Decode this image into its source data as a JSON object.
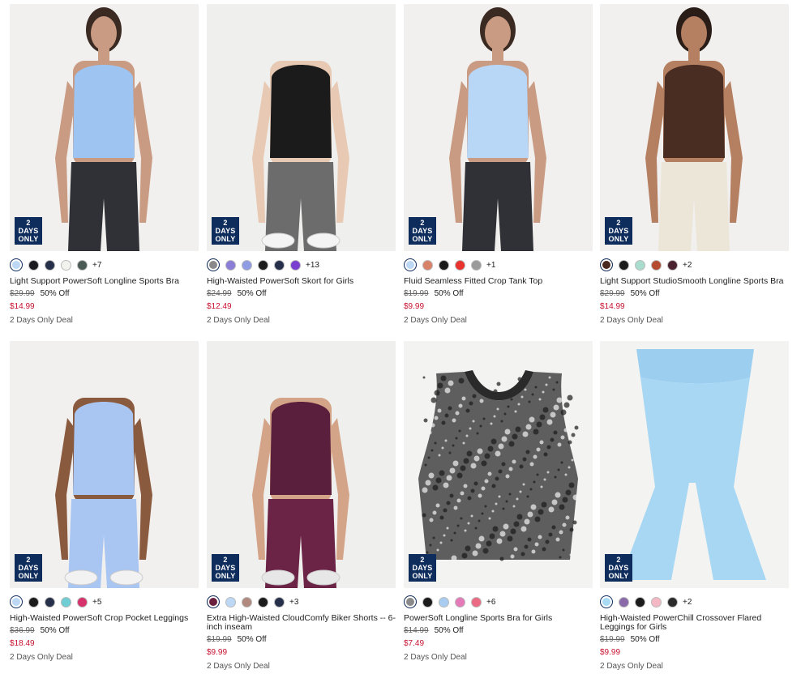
{
  "products": [
    {
      "name": "Light Support PowerSoft Longline Sports Bra",
      "orig_price": "$29.99",
      "discount": "50% Off",
      "sale_price": "$14.99",
      "deal": "2 Days Only Deal",
      "badge": "2 DAYS\nONLY",
      "swatches": [
        "#bcd8f5",
        "#1b1b1f",
        "#27304a",
        "#f2f2ee",
        "#4b5a54"
      ],
      "more": "+7",
      "image": {
        "bg": "#f1f0ee",
        "top": "#9ec4f2",
        "bottom": "#2f3136",
        "skin": "#c99b82",
        "hair": "#3a2a22",
        "shoes": "none"
      }
    },
    {
      "name": "High-Waisted PowerSoft Skort for Girls",
      "orig_price": "$24.99",
      "discount": "50% Off",
      "sale_price": "$12.49",
      "deal": "2 Days Only Deal",
      "badge": "2 DAYS\nONLY",
      "swatches": [
        "#8a8a8a",
        "#8a7ed6",
        "#8f9be2",
        "#1c1c1c",
        "#27304a",
        "#7a3fd0"
      ],
      "more": "+13",
      "image": {
        "bg": "#efefed",
        "top": "#1b1b1b",
        "bottom": "#6c6c6c",
        "skin": "#e8c9b3",
        "hair": "none",
        "shoes": "#f4f4f4"
      }
    },
    {
      "name": "Fluid Seamless Fitted Crop Tank Top",
      "orig_price": "$19.99",
      "discount": "50% Off",
      "sale_price": "$9.99",
      "deal": "2 Days Only Deal",
      "badge": "2 DAYS\nONLY",
      "swatches": [
        "#bcd8f5",
        "#d9826a",
        "#1b1b1b",
        "#e8332f",
        "#9a9a9a"
      ],
      "more": "+1",
      "image": {
        "bg": "#f1f0ee",
        "top": "#b8d6f6",
        "bottom": "#2f3136",
        "skin": "#c99b82",
        "hair": "#3a2a22",
        "shoes": "none"
      }
    },
    {
      "name": "Light Support StudioSmooth Longline Sports Bra",
      "orig_price": "$29.99",
      "discount": "50% Off",
      "sale_price": "$14.99",
      "deal": "2 Days Only Deal",
      "badge": "2 DAYS\nONLY",
      "swatches": [
        "#4a2a20",
        "#1b1b1b",
        "#a9dccd",
        "#b44a2e",
        "#4a2230"
      ],
      "more": "+2",
      "image": {
        "bg": "#f1f0ee",
        "top": "#4a2d22",
        "bottom": "#ece6d8",
        "skin": "#b57f62",
        "hair": "#2a1d17",
        "shoes": "none"
      }
    },
    {
      "name": "High-Waisted PowerSoft Crop Pocket Leggings",
      "orig_price": "$36.99",
      "discount": "50% Off",
      "sale_price": "$18.49",
      "deal": "2 Days Only Deal",
      "badge": "2 DAYS\nONLY",
      "swatches": [
        "#bcd8f5",
        "#1b1b1b",
        "#27304a",
        "#6fcdd3",
        "#d6336c"
      ],
      "more": "+5",
      "image": {
        "bg": "#f1f0ee",
        "top": "#a9c6f2",
        "bottom": "#a9c6f2",
        "skin": "#8a5a3e",
        "hair": "none",
        "shoes": "#f2f2f2"
      }
    },
    {
      "name": "Extra High-Waisted CloudComfy Biker Shorts -- 6-inch inseam",
      "orig_price": "$19.99",
      "discount": "50% Off",
      "sale_price": "$9.99",
      "deal": "2 Days Only Deal",
      "badge": "2 DAYS\nONLY",
      "swatches": [
        "#6b1f3e",
        "#bcd8f5",
        "#b08a7e",
        "#1b1b1b",
        "#27304a"
      ],
      "more": "+3",
      "image": {
        "bg": "#efefed",
        "top": "#5a1f3c",
        "bottom": "#6b2446",
        "skin": "#d4a488",
        "hair": "none",
        "shoes": "#e7e7e7"
      }
    },
    {
      "name": "PowerSoft Longline Sports Bra for Girls",
      "orig_price": "$14.99",
      "discount": "50% Off",
      "sale_price": "$7.49",
      "deal": "2 Days Only Deal",
      "badge": "2 DAYS\nONLY",
      "swatches": [
        "#8a8a8a",
        "#1b1b1b",
        "#a8cdf0",
        "#e47bb8",
        "#ea6b83"
      ],
      "more": "+6",
      "image": {
        "bg": "#f3f3f1",
        "top": "#5e5e5e",
        "bottom": "none",
        "skin": "none",
        "hair": "none",
        "shoes": "none"
      }
    },
    {
      "name": "High-Waisted PowerChill Crossover Flared Leggings for Girls",
      "orig_price": "$19.99",
      "discount": "50% Off",
      "sale_price": "$9.99",
      "deal": "2 Days Only Deal",
      "badge": "2 DAYS\nONLY",
      "swatches": [
        "#a9dbf5",
        "#8a6aa8",
        "#1b1b1b",
        "#f3b8c3",
        "#2b2b2b"
      ],
      "more": "+2",
      "image": {
        "bg": "#f3f3f1",
        "top": "none",
        "bottom": "#a8d7f4",
        "skin": "none",
        "hair": "none",
        "shoes": "none"
      }
    }
  ]
}
